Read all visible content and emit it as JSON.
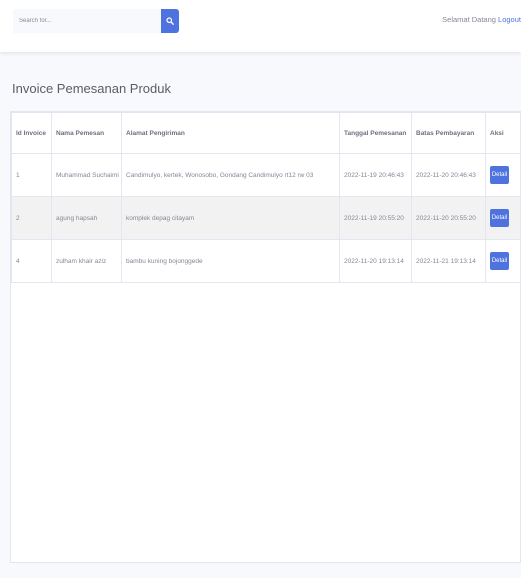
{
  "topbar": {
    "search_placeholder": "Search for...",
    "welcome_text": "Selamat Datang",
    "logout_label": "Logout"
  },
  "page": {
    "title": "Invoice Pemesanan Produk"
  },
  "table": {
    "headers": {
      "id": "Id Invoice",
      "name": "Nama Pemesan",
      "address": "Alamat Pengiriman",
      "order_date": "Tanggal Pemesanan",
      "due_date": "Batas Pembayaran",
      "action": "Aksi"
    },
    "rows": [
      {
        "id": "1",
        "name": "Muhammad Suchaimi",
        "address": "Candimulyo, kertek, Wonosobo, Gondang Candimulyo rt12 rw 03",
        "order_date": "2022-11-19 20:46:43",
        "due_date": "2022-11-20 20:46:43",
        "action_label": "Detail"
      },
      {
        "id": "2",
        "name": "agung hapsah",
        "address": "komplek depag citayam",
        "order_date": "2022-11-19 20:55:20",
        "due_date": "2022-11-20 20:55:20",
        "action_label": "Detail"
      },
      {
        "id": "4",
        "name": "zulham khair aziz",
        "address": "bambu kuning bojonggede",
        "order_date": "2022-11-20 19:13:14",
        "due_date": "2022-11-21 19:13:14",
        "action_label": "Detail"
      }
    ]
  },
  "colors": {
    "primary": "#4e73df",
    "background": "#f8f9fc",
    "text": "#5a5c69"
  },
  "icons": {
    "search": "search-icon"
  }
}
